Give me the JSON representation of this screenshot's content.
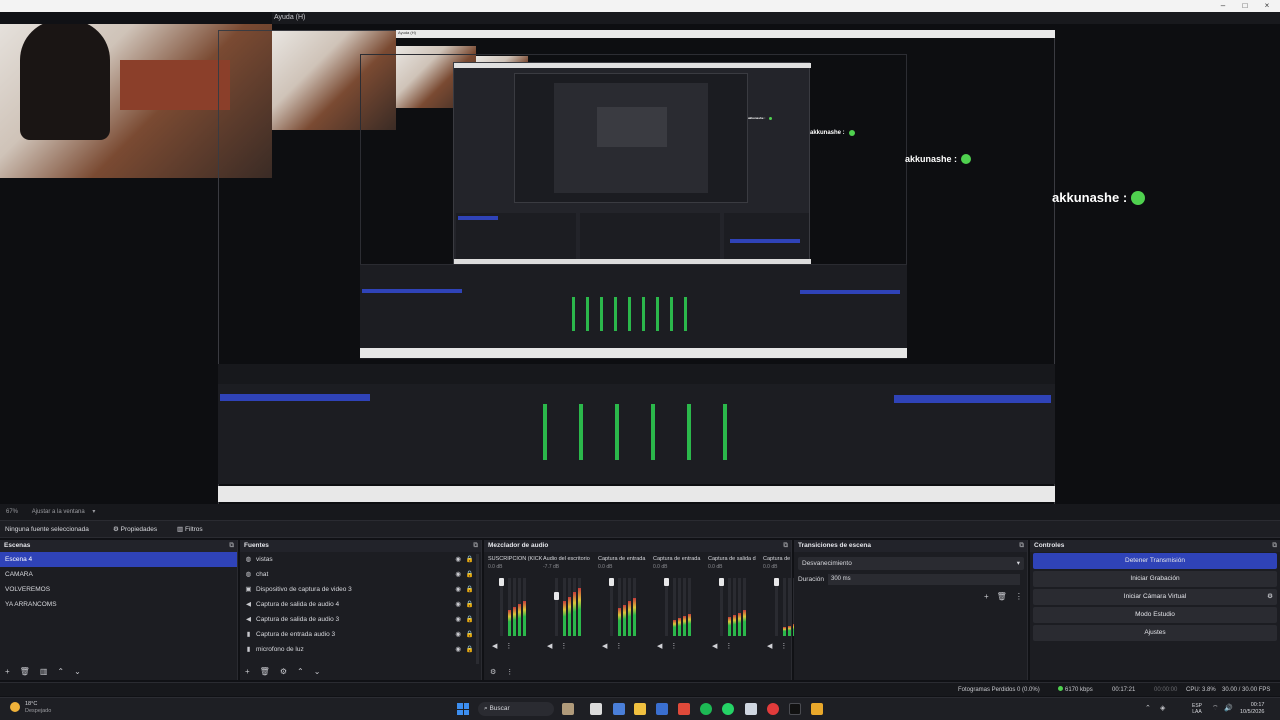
{
  "window": {
    "min": "–",
    "max": "□",
    "close": "×"
  },
  "menubar": {
    "label": "Ayuda (H)"
  },
  "preview": {
    "nested_menu": "Ayuda (H)",
    "chat": [
      {
        "user": "akkunashe :"
      },
      {
        "user": "akkunashe :"
      },
      {
        "user": "akkunashe :"
      }
    ]
  },
  "below_preview": {
    "zoom": "67%",
    "fit": "Ajustar a la ventana",
    "chevron": "▾"
  },
  "source_bar": {
    "no_source": "Ninguna fuente seleccionada",
    "properties": "Propiedades",
    "filters": "Filtros"
  },
  "scenes": {
    "title": "Escenas",
    "items": [
      "Escena 4",
      "CAMARA",
      "VOLVEREMOS",
      "YA ARRANCOMS"
    ],
    "selected": "Escena 4"
  },
  "sources": {
    "title": "Fuentes",
    "items": [
      {
        "label": "vistas",
        "icon": "browser-icon"
      },
      {
        "label": "chat",
        "icon": "browser-icon"
      },
      {
        "label": "Dispositivo de captura de video 3",
        "icon": "camera-icon"
      },
      {
        "label": "Captura de salida de audio 4",
        "icon": "speaker-icon"
      },
      {
        "label": "Captura de salida de audio 3",
        "icon": "speaker-icon"
      },
      {
        "label": "Captura de entrada audio 3",
        "icon": "mic-icon"
      },
      {
        "label": "microfono de luz",
        "icon": "mic-icon"
      }
    ]
  },
  "mixer": {
    "title": "Mezclador de audio",
    "channels": [
      {
        "name": "SUSCRIPCION (KICK)",
        "db": "0.0 dB",
        "level": 0.55
      },
      {
        "name": "Audio del escritorio",
        "db": "-7.7 dB",
        "level": 0.75
      },
      {
        "name": "Captura de entrada",
        "db": "0.0 dB",
        "level": 0.6
      },
      {
        "name": "Captura de entrada",
        "db": "0.0 dB",
        "level": 0.35
      },
      {
        "name": "Captura de salida d",
        "db": "0.0 dB",
        "level": 0.4
      },
      {
        "name": "Captura de",
        "db": "0.0 dB",
        "level": 0.2
      }
    ]
  },
  "transitions": {
    "title": "Transiciones de escena",
    "selected": "Desvanecimiento",
    "duration_label": "Duración",
    "duration_value": "300 ms"
  },
  "controls": {
    "title": "Controles",
    "buttons": [
      "Detener Transmisión",
      "Iniciar Grabación",
      "Iniciar Cámara Virtual",
      "Modo Estudio",
      "Ajustes"
    ],
    "active": "Detener Transmisión"
  },
  "status": {
    "dropped": "Fotogramas Perdidos 0 (0.0%)",
    "kbps": "6170 kbps",
    "live_time": "00:17:21",
    "rec_time": "00:00:00",
    "cpu": "CPU: 3.8%",
    "fps": "30.00 / 30.00 FPS"
  },
  "taskbar": {
    "weather": "18°C",
    "weather_desc": "Despejado",
    "search": "Buscar",
    "lang1": "ESP",
    "lang2": "LAA",
    "time": "00:17",
    "date": "10/5/2026"
  },
  "colors": {
    "accent": "#2f43b8",
    "meter_green": "#2bb84b",
    "meter_yellow": "#d9c43a",
    "meter_red": "#c73b3b"
  }
}
